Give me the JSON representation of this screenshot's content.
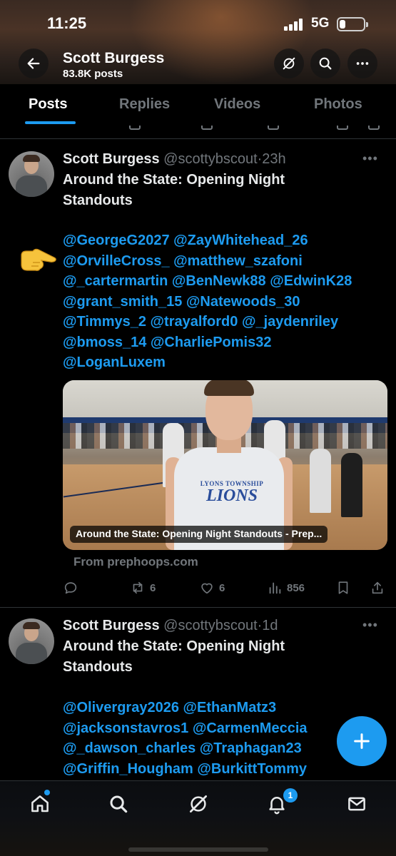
{
  "status_bar": {
    "time": "11:25",
    "network": "5G",
    "battery_level": 0.25
  },
  "header": {
    "title": "Scott Burgess",
    "subtitle": "83.8K posts"
  },
  "tabs": [
    {
      "label": "Posts",
      "active": true
    },
    {
      "label": "Replies",
      "active": false
    },
    {
      "label": "Videos",
      "active": false
    },
    {
      "label": "Photos",
      "active": false
    }
  ],
  "posts": [
    {
      "name": "Scott Burgess",
      "handle": "@scottybscout",
      "separator": "·",
      "time": "23h",
      "text_lines": [
        "Around the State: Opening Night",
        "Standouts"
      ],
      "mention_lines": [
        "@GeorgeG2027 @ZayWhitehead_26",
        "@OrvilleCross_ @matthew_szafoni",
        "@_cartermartin @BenNewk88 @EdwinK28",
        "@grant_smith_15 @Natewoods_30",
        "@Timmys_2 @trayalford0 @_jaydenriley",
        "@bmoss_14 @CharliePomis32",
        "@LoganLuxem"
      ],
      "card": {
        "caption": "Around the State: Opening Night Standouts - Prep...",
        "jersey_line1": "LYONS TOWNSHIP",
        "jersey_line2": "LIONS"
      },
      "source": "From prephoops.com",
      "stats": {
        "reposts": "6",
        "likes": "6",
        "views": "856"
      }
    },
    {
      "name": "Scott Burgess",
      "handle": "@scottybscout",
      "separator": "·",
      "time": "1d",
      "text_lines": [
        "Around the State: Opening Night",
        "Standouts"
      ],
      "mention_lines": [
        "@Olivergray2026 @EthanMatz3",
        "@jacksonstavros1 @CarmenMeccia",
        "@_dawson_charles @Traphagan23",
        "@Griffin_Hougham @BurkittTommy"
      ]
    }
  ],
  "avatar_logo": "NKE\nSCOUT",
  "bottom_nav": {
    "notifications_badge": "1"
  },
  "colors": {
    "accent": "#1d9bf0",
    "text": "#e7e9ea",
    "muted": "#71767b",
    "divider": "#2f3336"
  }
}
